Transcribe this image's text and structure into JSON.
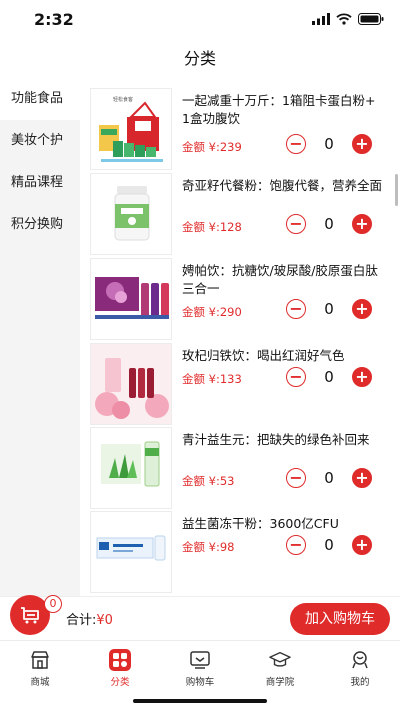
{
  "status": {
    "time": "2:32"
  },
  "nav": {
    "title": "分类"
  },
  "sidebar": {
    "items": [
      {
        "label": "功能食品",
        "active": true
      },
      {
        "label": "美妆个护",
        "active": false
      },
      {
        "label": "精品课程",
        "active": false
      },
      {
        "label": "积分换购",
        "active": false
      }
    ]
  },
  "products": [
    {
      "title": "一起减重十万斤：1箱阻卡蛋白粉+1盒功腹饮",
      "price": "金额 ¥:239",
      "qty": "0",
      "thumb_label": "轻松食客"
    },
    {
      "title": "奇亚籽代餐粉：饱腹代餐，营养全面",
      "price": "金额 ¥:128",
      "qty": "0",
      "thumb_label": ""
    },
    {
      "title": "娉帕饮：抗糖饮/玻尿酸/胶原蛋白肽三合一",
      "price": "金额 ¥:290",
      "qty": "0",
      "thumb_label": ""
    },
    {
      "title": "玫杞归铁饮：喝出红润好气色",
      "price": "金额 ¥:133",
      "qty": "0",
      "thumb_label": ""
    },
    {
      "title": "青汁益生元：把缺失的绿色补回来",
      "price": "金额 ¥:53",
      "qty": "0",
      "thumb_label": ""
    },
    {
      "title": "益生菌冻干粉：3600亿CFU",
      "price": "金额 ¥:98",
      "qty": "0",
      "thumb_label": ""
    }
  ],
  "cart": {
    "badge": "0",
    "total_label": "合计:",
    "total_value": "¥0",
    "add_button": "加入购物车"
  },
  "tabs": [
    {
      "label": "商城",
      "icon": "store-icon",
      "active": false
    },
    {
      "label": "分类",
      "icon": "category-icon",
      "active": true
    },
    {
      "label": "购物车",
      "icon": "cart-icon",
      "active": false
    },
    {
      "label": "商学院",
      "icon": "graduation-cap-icon",
      "active": false
    },
    {
      "label": "我的",
      "icon": "profile-icon",
      "active": false
    }
  ],
  "colors": {
    "accent": "#e02b2b",
    "sidebar_bg": "#f4f4f4",
    "text": "#111111"
  }
}
